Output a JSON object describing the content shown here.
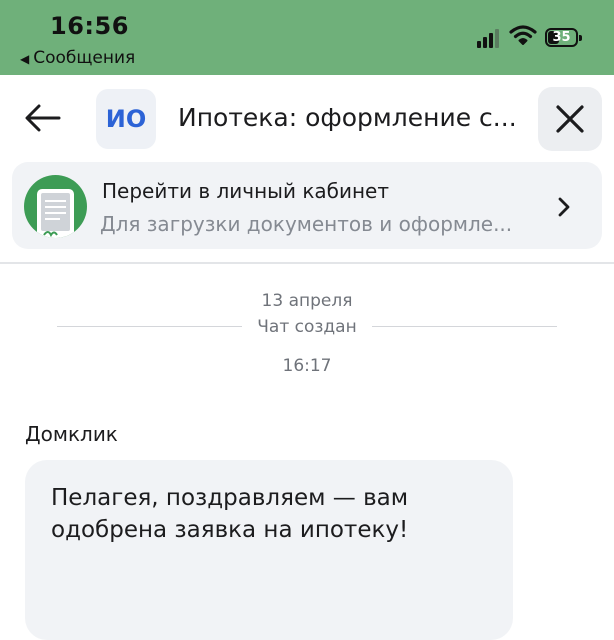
{
  "status_bar": {
    "time": "16:56",
    "back_app": "Сообщения",
    "battery_percent": "35",
    "signal_icon": "signal-bars-icon",
    "wifi_icon": "wifi-icon"
  },
  "header": {
    "back_icon": "arrow-left-icon",
    "avatar_initials": "ИО",
    "title": "Ипотека: оформление с...",
    "close_icon": "close-icon"
  },
  "cabinet_card": {
    "title": "Перейти в личный кабинет",
    "subtitle": "Для загрузки документов и оформле...",
    "chevron_icon": "chevron-right-icon"
  },
  "chat": {
    "date": "13 апреля",
    "system_message": "Чат создан",
    "system_time": "16:17",
    "messages": [
      {
        "sender": "Домклик",
        "text": "Пелагея, поздравляем — вам одобрена заявка на ипотеку!"
      }
    ]
  },
  "colors": {
    "status_bar_bg": "#6fb07a",
    "avatar_text": "#2c63d6",
    "card_bg": "#f1f3f6",
    "doc_icon_bg": "#3d9c55"
  }
}
